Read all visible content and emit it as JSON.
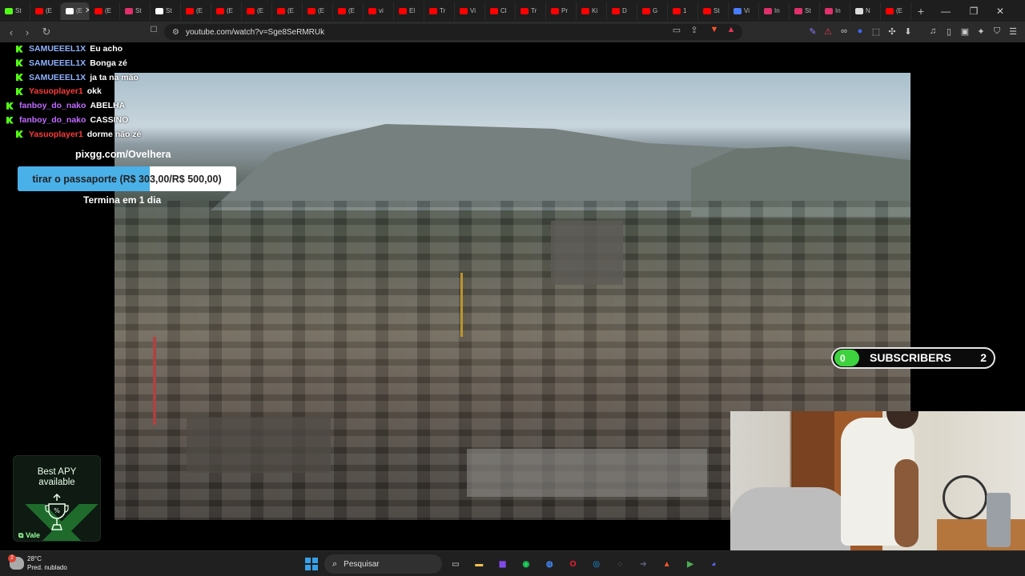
{
  "browser": {
    "tabs": [
      {
        "label": "St",
        "color": "#53fc18"
      },
      {
        "label": "(E",
        "color": "#ff0000"
      },
      {
        "label": "(E",
        "color": "#ffffff",
        "active": true
      },
      {
        "label": "(E",
        "color": "#ff0000"
      },
      {
        "label": "St",
        "color": "#e1306c"
      },
      {
        "label": "St",
        "color": "#ffffff"
      },
      {
        "label": "(E",
        "color": "#ff0000"
      },
      {
        "label": "(E",
        "color": "#ff0000"
      },
      {
        "label": "(E",
        "color": "#ff0000"
      },
      {
        "label": "(E",
        "color": "#ff0000"
      },
      {
        "label": "(E",
        "color": "#ff0000"
      },
      {
        "label": "(E",
        "color": "#ff0000"
      },
      {
        "label": "vi",
        "color": "#ff0000"
      },
      {
        "label": "El",
        "color": "#ff0000"
      },
      {
        "label": "Tr",
        "color": "#ff0000"
      },
      {
        "label": "Vi",
        "color": "#ff0000"
      },
      {
        "label": "Cl",
        "color": "#ff0000"
      },
      {
        "label": "Tr",
        "color": "#ff0000"
      },
      {
        "label": "Pr",
        "color": "#ff0000"
      },
      {
        "label": "Ki",
        "color": "#ff0000"
      },
      {
        "label": "D",
        "color": "#ff0000"
      },
      {
        "label": "G",
        "color": "#ff0000"
      },
      {
        "label": "1",
        "color": "#ff0000"
      },
      {
        "label": "St",
        "color": "#ff0000"
      },
      {
        "label": "Vi",
        "color": "#4a7cff"
      },
      {
        "label": "In",
        "color": "#e1306c"
      },
      {
        "label": "St",
        "color": "#e1306c"
      },
      {
        "label": "In",
        "color": "#e1306c"
      },
      {
        "label": "N",
        "color": "#dddddd"
      },
      {
        "label": "(E",
        "color": "#ff0000"
      }
    ],
    "close_glyph": "✕",
    "new_tab_glyph": "+",
    "window_controls": {
      "minimize": "—",
      "maximize": "❐",
      "close": "✕"
    },
    "back_glyph": "‹",
    "forward_glyph": "›",
    "reload_glyph": "↻",
    "bookmark_glyph": "🔖",
    "url": "youtube.com/watch?v=Sge8SeRMRUk",
    "extension_icons": [
      "brush-icon",
      "red-ext-icon",
      "mask-icon",
      "circle-ext-icon",
      "square-ext-icon",
      "puzzle-icon",
      "download-icon",
      "music-icon",
      "sidebar-icon",
      "wallet-icon",
      "sparkle-icon",
      "shield-icon",
      "menu-icon"
    ]
  },
  "chat": {
    "messages": [
      {
        "user": "SAMUEEEL1X",
        "user_color": "#8fb2ff",
        "message": "Eu acho",
        "badge": true
      },
      {
        "user": "SAMUEEEL1X",
        "user_color": "#8fb2ff",
        "message": "Bonga zé",
        "badge": true
      },
      {
        "user": "SAMUEEEL1X",
        "user_color": "#8fb2ff",
        "message": "ja ta na mão",
        "badge": true
      },
      {
        "user": "Yasuoplayer1",
        "user_color": "#ff3a3a",
        "message": "okk",
        "badge": true
      },
      {
        "user": "fanboy_do_nako",
        "user_color": "#c06bff",
        "message": "ABELHA",
        "badge": true
      },
      {
        "user": "fanboy_do_nako",
        "user_color": "#c06bff",
        "message": "CASSINO",
        "badge": true
      },
      {
        "user": "Yasuoplayer1",
        "user_color": "#ff3a3a",
        "message": "dorme não zé",
        "badge": true
      }
    ]
  },
  "donation": {
    "url": "pixgg.com/Ovelhera",
    "goal_label": "tirar o passaporte (R$ 303,00/R$ 500,00)",
    "goal_current": 303,
    "goal_target": 500,
    "goal_fill_color": "#4ab0e8",
    "ends": "Termina em 1 dia"
  },
  "ad": {
    "title_line1": "Best APY",
    "title_line2": "available",
    "brand": "Vale",
    "icon": "trophy-percent-icon"
  },
  "subscribers": {
    "count": "0",
    "label": "SUBSCRIBERS",
    "goal": "2",
    "accent": "#3fd23f"
  },
  "taskbar": {
    "weather_temp": "28°C",
    "weather_desc": "Pred. nublado",
    "weather_badge": "2",
    "search_placeholder": "Pesquisar",
    "apps": [
      {
        "name": "task-view-icon",
        "color": "#9a9a9a"
      },
      {
        "name": "file-explorer-icon",
        "color": "#f2c14e"
      },
      {
        "name": "app-grid-icon",
        "color": "#8a4fff"
      },
      {
        "name": "spotify-icon",
        "color": "#1ed760"
      },
      {
        "name": "chrome-icon",
        "color": "#4285f4"
      },
      {
        "name": "opera-icon",
        "color": "#ff1b2d"
      },
      {
        "name": "steam-icon",
        "color": "#1b6fa8"
      },
      {
        "name": "app-icon",
        "color": "#888888"
      },
      {
        "name": "arrow-app-icon",
        "color": "#555a70"
      },
      {
        "name": "brave-icon",
        "color": "#fb542b"
      },
      {
        "name": "play-app-icon",
        "color": "#4caf50"
      },
      {
        "name": "discord-icon",
        "color": "#5865f2"
      }
    ]
  }
}
